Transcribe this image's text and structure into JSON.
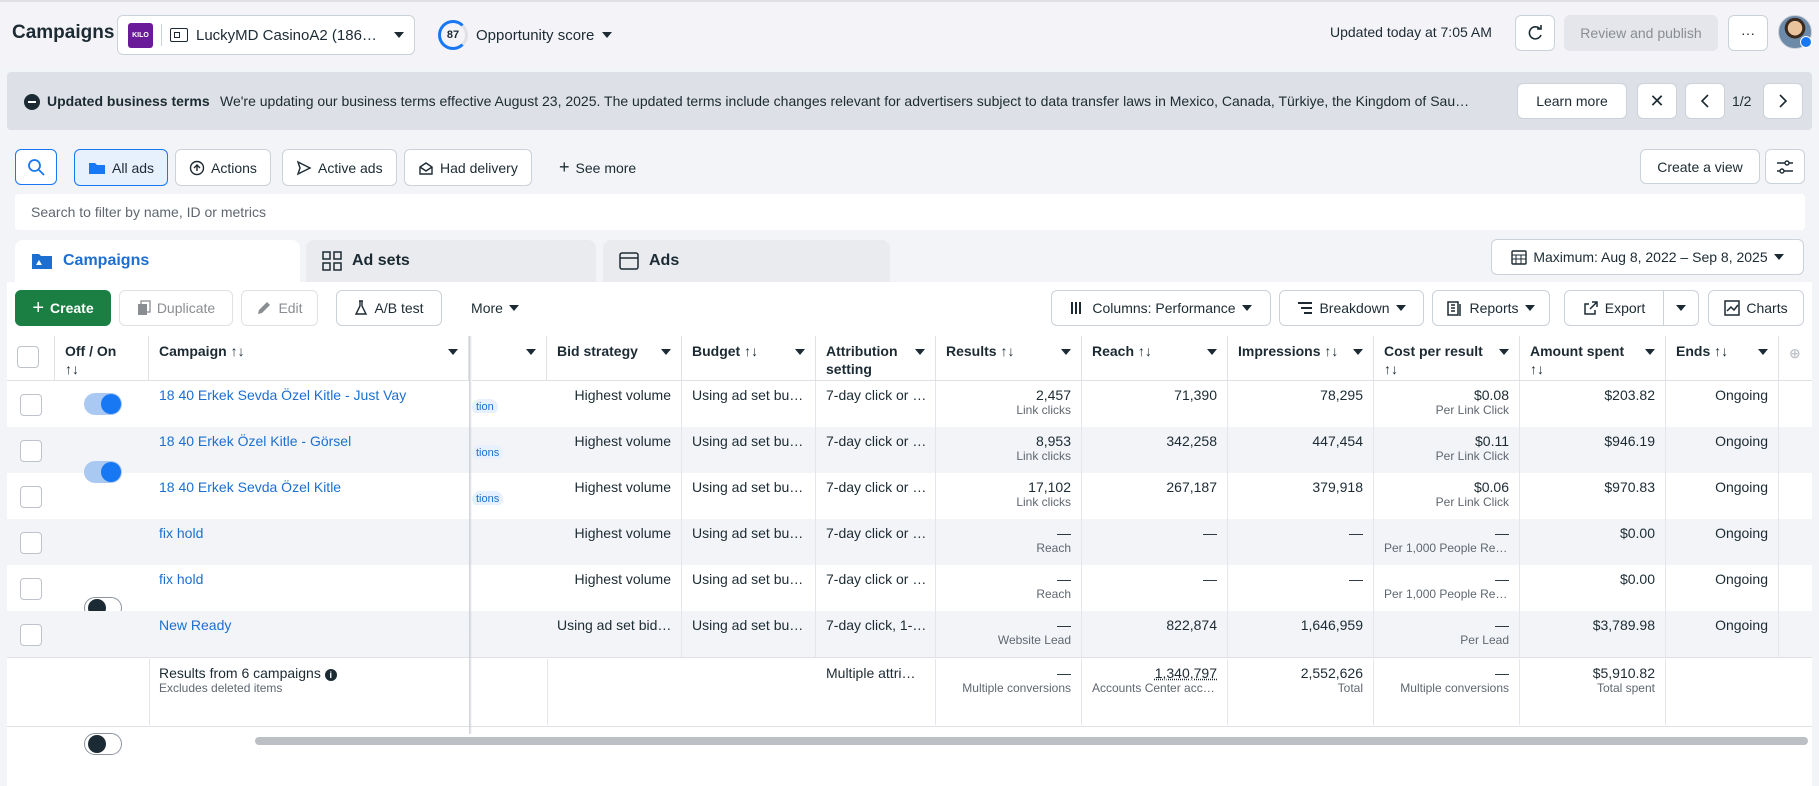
{
  "header": {
    "title": "Campaigns",
    "account_logo_text": "KILO",
    "account_name": "LuckyMD CasinoA2 (186…",
    "opportunity_score": "87",
    "opportunity_label": "Opportunity score",
    "updated": "Updated today at 7:05 AM",
    "publish_label": "Review and publish",
    "more_label": "···"
  },
  "banner": {
    "title": "Updated business terms",
    "text": "We're updating our business terms effective August 23, 2025. The updated terms include changes relevant for advertisers subject to data transfer laws in Mexico, Canada, Türkiye, the Kingdom of Sau…",
    "learn_more": "Learn more",
    "close": "✕",
    "pager": "1/2"
  },
  "filters": {
    "items": [
      "All ads",
      "Actions",
      "Active ads",
      "Had delivery",
      "See more"
    ],
    "create_view": "Create a view",
    "search_placeholder": "Search to filter by name, ID or metrics"
  },
  "tabs": [
    "Campaigns",
    "Ad sets",
    "Ads"
  ],
  "date_range": "Maximum: Aug 8, 2022 – Sep 8, 2025",
  "toolbar": {
    "create": "Create",
    "duplicate": "Duplicate",
    "edit": "Edit",
    "ab_test": "A/B test",
    "more": "More",
    "columns": "Columns: Performance",
    "breakdown": "Breakdown",
    "reports": "Reports",
    "export": "Export",
    "charts": "Charts"
  },
  "table": {
    "headers": {
      "off_on": "Off / On",
      "campaign": "Campaign",
      "bid_strategy": "Bid strategy",
      "budget": "Budget",
      "attribution": "Attribution setting",
      "results": "Results",
      "reach": "Reach",
      "impressions": "Impressions",
      "cost_per_result": "Cost per result",
      "amount_spent": "Amount spent",
      "ends": "Ends",
      "sort_glyph": "↑↓"
    },
    "rows": [
      {
        "on": true,
        "name": "18 40 Erkek Sevda Özel Kitle - Just Vay",
        "chip": "tion",
        "bid": "Highest volume",
        "budget": "Using ad set bu…",
        "attr": "7-day click or …",
        "results": "2,457",
        "results_sub": "Link clicks",
        "reach": "71,390",
        "impressions": "78,295",
        "cpr": "$0.08",
        "cpr_sub": "Per Link Click",
        "spent": "$203.82",
        "ends": "Ongoing"
      },
      {
        "on": true,
        "name": "18 40 Erkek Özel Kitle - Görsel",
        "chip": "tions",
        "bid": "Highest volume",
        "budget": "Using ad set bu…",
        "attr": "7-day click or …",
        "results": "8,953",
        "results_sub": "Link clicks",
        "reach": "342,258",
        "impressions": "447,454",
        "cpr": "$0.11",
        "cpr_sub": "Per Link Click",
        "spent": "$946.19",
        "ends": "Ongoing"
      },
      {
        "on": true,
        "name": "18 40 Erkek Sevda Özel Kitle",
        "chip": "tions",
        "bid": "Highest volume",
        "budget": "Using ad set bu…",
        "attr": "7-day click or …",
        "results": "17,102",
        "results_sub": "Link clicks",
        "reach": "267,187",
        "impressions": "379,918",
        "cpr": "$0.06",
        "cpr_sub": "Per Link Click",
        "spent": "$970.83",
        "ends": "Ongoing"
      },
      {
        "on": false,
        "name": "fix hold",
        "chip": "",
        "bid": "Highest volume",
        "budget": "Using ad set bu…",
        "attr": "7-day click or …",
        "results": "—",
        "results_sub": "Reach",
        "reach": "—",
        "impressions": "—",
        "cpr": "—",
        "cpr_sub": "Per 1,000 People Rea…",
        "spent": "$0.00",
        "ends": "Ongoing"
      },
      {
        "on": false,
        "name": "fix hold",
        "chip": "",
        "bid": "Highest volume",
        "budget": "Using ad set bu…",
        "attr": "7-day click or …",
        "results": "—",
        "results_sub": "Reach",
        "reach": "—",
        "impressions": "—",
        "cpr": "—",
        "cpr_sub": "Per 1,000 People Rea…",
        "spent": "$0.00",
        "ends": "Ongoing"
      },
      {
        "on": false,
        "name": "New Ready",
        "chip": "",
        "bid": "Using ad set bid…",
        "budget": "Using ad set bu…",
        "attr": "7-day click, 1-…",
        "results": "—",
        "results_sub": "Website Lead",
        "reach": "822,874",
        "impressions": "1,646,959",
        "cpr": "—",
        "cpr_sub": "Per Lead",
        "spent": "$3,789.98",
        "ends": "Ongoing"
      }
    ],
    "totals": {
      "label": "Results from 6 campaigns",
      "sub": "Excludes deleted items",
      "attr": "Multiple attri…",
      "results": "—",
      "results_sub": "Multiple conversions",
      "reach": "1,340,797",
      "reach_sub": "Accounts Center acco…",
      "impressions": "2,552,626",
      "impressions_sub": "Total",
      "cpr": "—",
      "cpr_sub": "Multiple conversions",
      "spent": "$5,910.82",
      "spent_sub": "Total spent"
    }
  }
}
